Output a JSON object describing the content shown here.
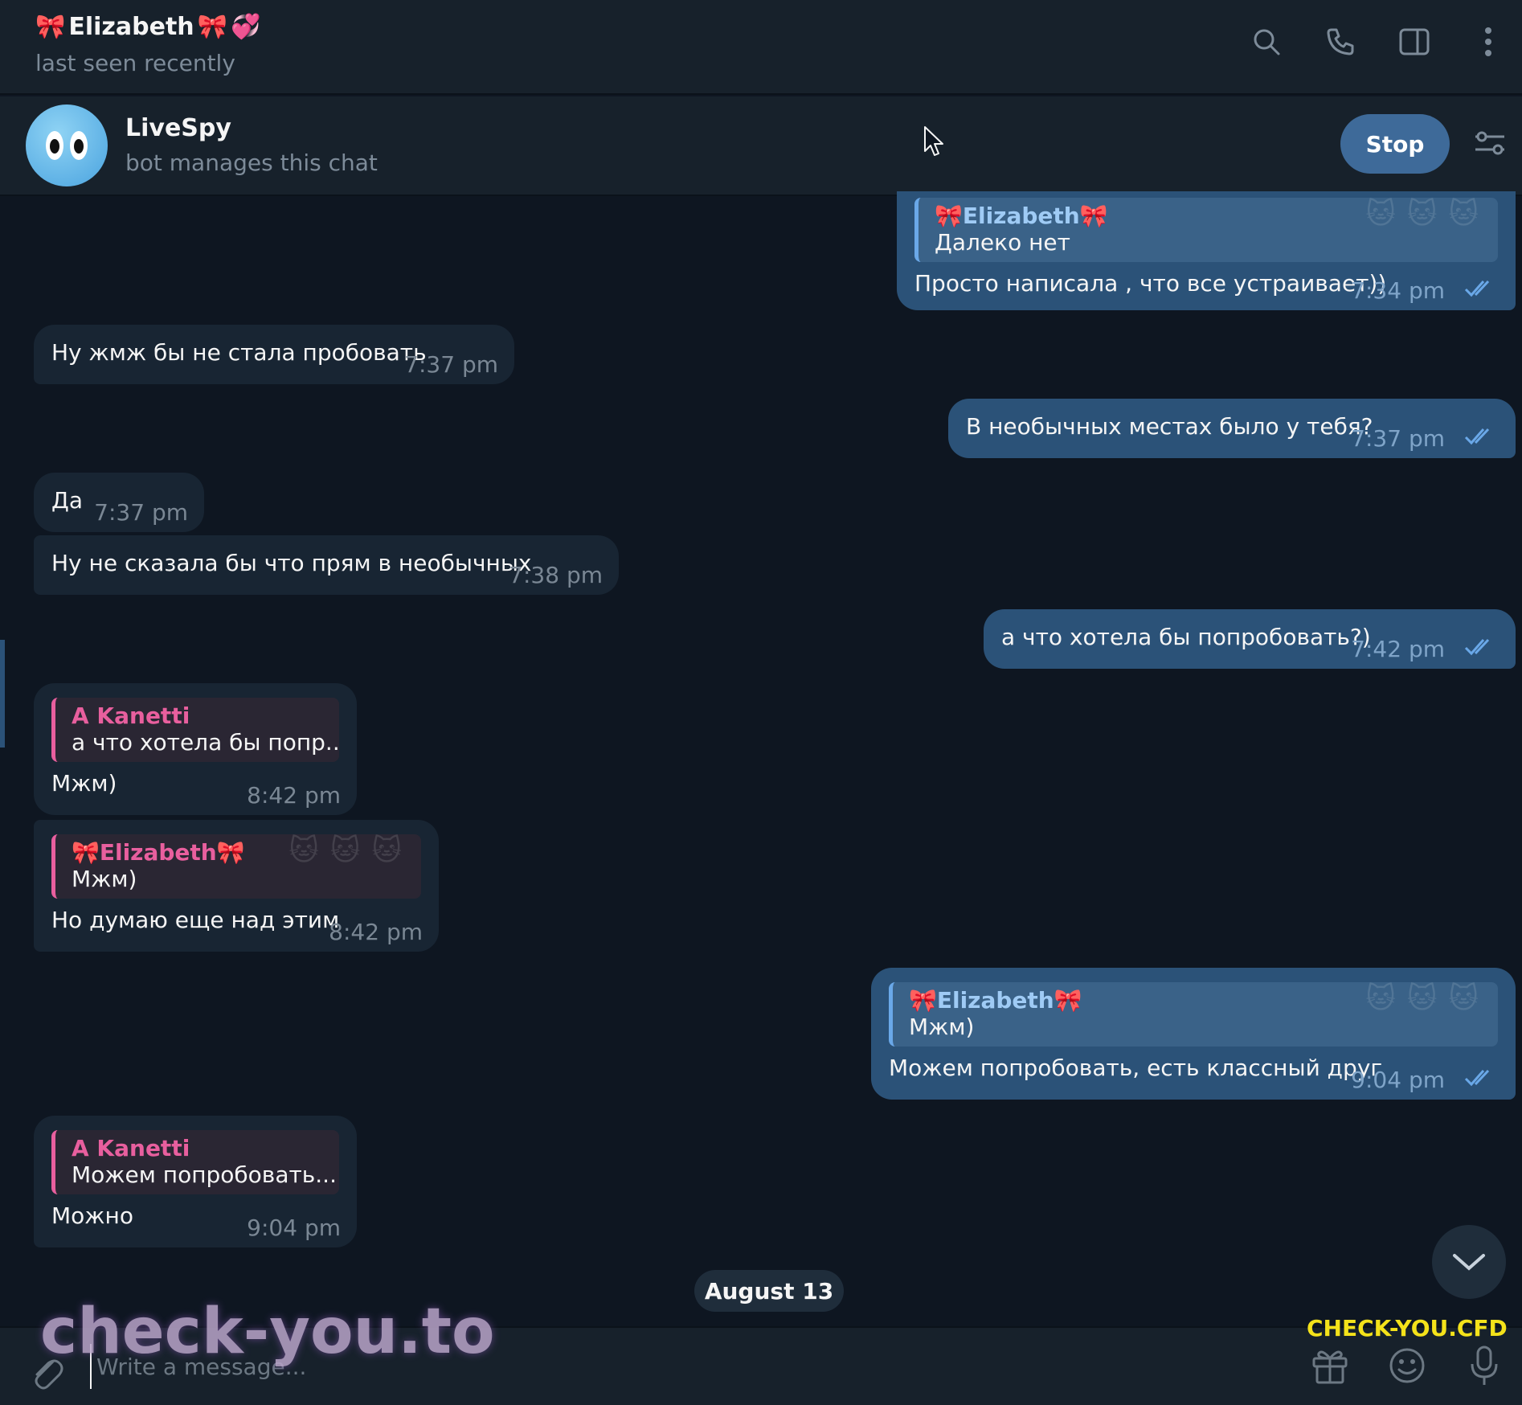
{
  "header": {
    "name": "Elizabeth",
    "name_prefix_emoji": "🎀",
    "name_suffix_emoji": "🎀",
    "name_hearts_emoji": "💞",
    "status": "last seen recently",
    "icons": [
      "search-icon",
      "phone-icon",
      "sidebar-toggle-icon",
      "more-vertical-icon"
    ]
  },
  "botbar": {
    "name": "LiveSpy",
    "subtitle": "bot manages this chat",
    "stop_label": "Stop"
  },
  "messages": [
    {
      "dir": "out",
      "reply_name": "🎀Elizabeth🎀",
      "reply_text": "Далеко нет",
      "text": "Просто написала , что все устраивает))",
      "time": "7:34 pm"
    },
    {
      "dir": "in",
      "text": "Ну жмж бы не стала пробовать",
      "time": "7:37 pm"
    },
    {
      "dir": "out",
      "text": "В необычных местах было у тебя?",
      "time": "7:37 pm"
    },
    {
      "dir": "in",
      "text": "Да",
      "time": "7:37 pm"
    },
    {
      "dir": "in",
      "text": "Ну не сказала бы что прям в необычных",
      "time": "7:38 pm"
    },
    {
      "dir": "out",
      "text": "а что хотела бы попробовать?)",
      "time": "7:42 pm"
    },
    {
      "dir": "in",
      "reply_name": "A Kanetti",
      "reply_text": "а что хотела бы попр...",
      "text": "Мжм)",
      "time": "8:42 pm"
    },
    {
      "dir": "in",
      "reply_name": "🎀Elizabeth🎀",
      "reply_text": "Мжм)",
      "text": "Но думаю еще над этим",
      "time": "8:42 pm"
    },
    {
      "dir": "out",
      "reply_name": "🎀Elizabeth🎀",
      "reply_text": "Мжм)",
      "text": "Можем попробовать, есть классный друг",
      "time": "9:04 pm"
    },
    {
      "dir": "in",
      "reply_name": "A Kanetti",
      "reply_text": "Можем попробовать...",
      "text": "Можно",
      "time": "9:04 pm"
    }
  ],
  "date_separator": "August 13",
  "input": {
    "placeholder": "Write a message..."
  },
  "watermarks": {
    "left": "check-you.to",
    "right": "CHECK-YOU.CFD"
  },
  "colors": {
    "bg": "#0e1621",
    "panel": "#17212b",
    "incoming": "#182533",
    "outgoing": "#2b5278",
    "accent": "#3e6a99",
    "reply_in": "#e85f9e",
    "reply_out": "#9fcbf5"
  }
}
